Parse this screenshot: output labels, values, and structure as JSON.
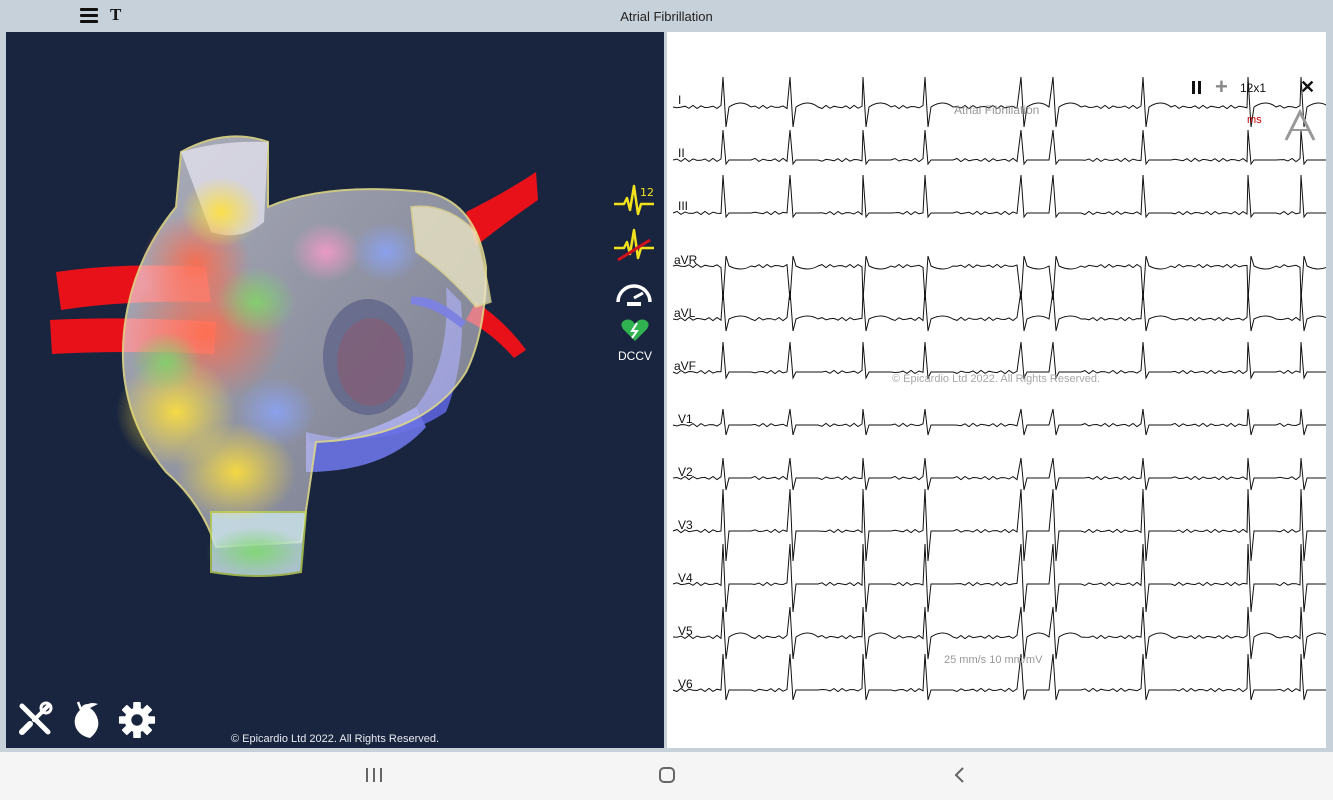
{
  "app": {
    "title": "Atrial Fibrillation",
    "menu_icon": "hamburger-menu-icon",
    "text_icon": "T"
  },
  "heart_view": {
    "copyright": "© Epicardio Ltd 2022. All Rights Reserved.",
    "side_tools": [
      {
        "icon": "ecg-12-lead-icon",
        "text": "12"
      },
      {
        "icon": "ecg-disabled-icon"
      },
      {
        "icon": "speedometer-icon"
      },
      {
        "icon": "heart-shock-icon",
        "label": "DCCV"
      }
    ],
    "bottom_tools": [
      {
        "icon": "tools-icon"
      },
      {
        "icon": "heart-anatomy-icon"
      },
      {
        "icon": "gear-icon"
      }
    ],
    "colors": {
      "background": "#19253f",
      "vessels": "#e8111a",
      "accent": "#f2e21c"
    }
  },
  "ecg": {
    "rhythm_label": "Atrial Fibrillation",
    "copyright": "© Epicardio Ltd 2022. All Rights Reserved.",
    "calibration": "25 mm/s  10 mm/mV",
    "layout_toggle": "12x1",
    "units_label": "ms",
    "controls": [
      "pause-icon",
      "plus-icon",
      "close-icon",
      "caliper-icon"
    ],
    "leads": [
      "I",
      "II",
      "III",
      "aVR",
      "aVL",
      "aVF",
      "V1",
      "V2",
      "V3",
      "V4",
      "V5",
      "V6"
    ]
  },
  "navbar": {
    "buttons": [
      "recent-apps-icon",
      "home-icon",
      "back-icon"
    ]
  }
}
